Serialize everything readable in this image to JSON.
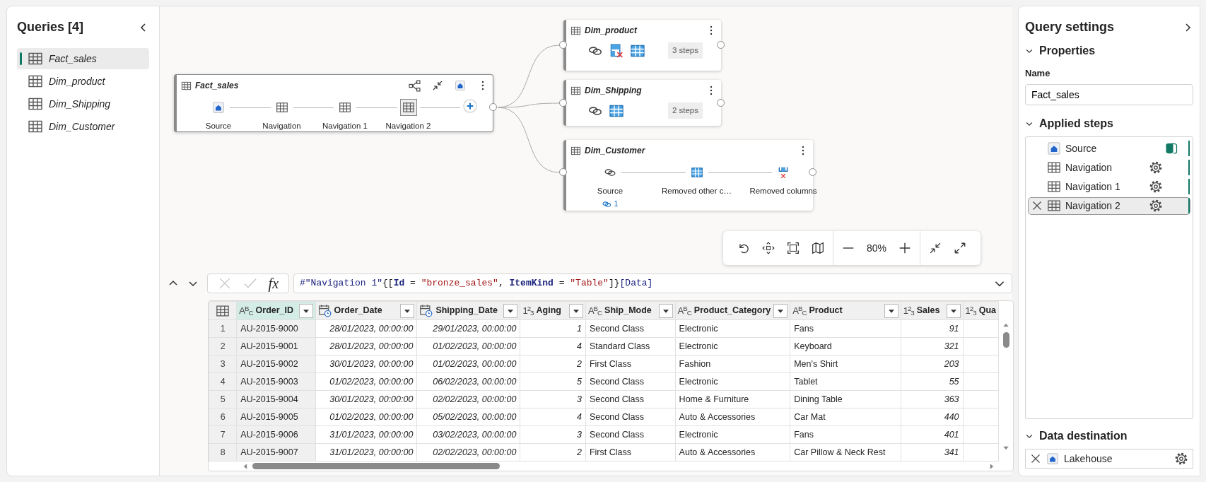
{
  "queries_panel": {
    "title": "Queries [4]",
    "items": [
      {
        "label": "Fact_sales",
        "selected": true
      },
      {
        "label": "Dim_product",
        "selected": false
      },
      {
        "label": "Dim_Shipping",
        "selected": false
      },
      {
        "label": "Dim_Customer",
        "selected": false
      }
    ]
  },
  "diagram": {
    "nodes": [
      {
        "title": "Fact_sales",
        "expanded": true,
        "selected": true,
        "steps": [
          {
            "label": "Source",
            "kind": "lakehouse",
            "selected": false
          },
          {
            "label": "Navigation",
            "kind": "table",
            "selected": false
          },
          {
            "label": "Navigation 1",
            "kind": "table",
            "selected": false
          },
          {
            "label": "Navigation 2",
            "kind": "table",
            "selected": true
          }
        ]
      },
      {
        "title": "Dim_product",
        "expanded": false,
        "selected": false,
        "steps": [
          {
            "kind": "link"
          },
          {
            "kind": "removerows"
          },
          {
            "kind": "grid"
          }
        ],
        "step_count": "3 steps"
      },
      {
        "title": "Dim_Shipping",
        "expanded": false,
        "selected": false,
        "steps": [
          {
            "kind": "link"
          },
          {
            "kind": "grid"
          }
        ],
        "step_count": "2 steps"
      },
      {
        "title": "Dim_Customer",
        "expanded": true,
        "selected": false,
        "steps": [
          {
            "label": "Source",
            "kind": "link",
            "selected": false,
            "link_count": "1"
          },
          {
            "label": "Removed other c…",
            "kind": "grid",
            "selected": false
          },
          {
            "label": "Removed columns",
            "kind": "removecols",
            "selected": false
          }
        ]
      }
    ],
    "zoom": "80%"
  },
  "formula": {
    "fx": "fx",
    "tokens": [
      {
        "text": "#\"Navigation 1\"",
        "kind": "name"
      },
      {
        "text": "{[",
        "kind": "plain"
      },
      {
        "text": "Id",
        "kind": "keyword"
      },
      {
        "text": " = ",
        "kind": "plain"
      },
      {
        "text": "\"bronze_sales\"",
        "kind": "string"
      },
      {
        "text": ", ",
        "kind": "plain"
      },
      {
        "text": "ItemKind",
        "kind": "keyword"
      },
      {
        "text": " = ",
        "kind": "plain"
      },
      {
        "text": "\"Table\"",
        "kind": "string"
      },
      {
        "text": "]}",
        "kind": "plain"
      },
      {
        "text": "[Data]",
        "kind": "name"
      }
    ]
  },
  "table": {
    "columns": [
      {
        "name": "Order_ID",
        "kind": "text",
        "type_label": "A$^{B}$$_{C}$",
        "selected": true,
        "filter_button": true
      },
      {
        "name": "Order_Date",
        "kind": "datetime",
        "selected": false,
        "filter_button": true
      },
      {
        "name": "Shipping_Date",
        "kind": "datetime",
        "selected": false,
        "filter_button": true
      },
      {
        "name": "Aging",
        "kind": "number",
        "type_label": "1$^{2}$$_{3}$",
        "selected": false,
        "filter_button": true
      },
      {
        "name": "Ship_Mode",
        "kind": "text",
        "type_label": "A$^{B}$$_{C}$",
        "selected": false,
        "filter_button": true
      },
      {
        "name": "Product_Category",
        "kind": "text",
        "type_label": "A$^{B}$$_{C}$",
        "selected": false,
        "filter_button": true
      },
      {
        "name": "Product",
        "kind": "text",
        "type_label": "A$^{B}$$_{C}$",
        "selected": false,
        "filter_button": true
      },
      {
        "name": "Sales",
        "kind": "number",
        "type_label": "1$^{2}$$_{3}$",
        "selected": false,
        "filter_button": true
      },
      {
        "name": "Qua",
        "kind": "number",
        "type_label": "1$^{2}$$_{3}$",
        "selected": false,
        "filter_button": false
      }
    ],
    "rows": [
      {
        "number": "1",
        "cells": [
          "AU-2015-9000",
          "28/01/2023, 00:00:00",
          "29/01/2023, 00:00:00",
          "1",
          "Second Class",
          "Electronic",
          "Fans",
          "91"
        ]
      },
      {
        "number": "2",
        "cells": [
          "AU-2015-9001",
          "28/01/2023, 00:00:00",
          "01/02/2023, 00:00:00",
          "4",
          "Standard Class",
          "Electronic",
          "Keyboard",
          "321"
        ]
      },
      {
        "number": "3",
        "cells": [
          "AU-2015-9002",
          "30/01/2023, 00:00:00",
          "01/02/2023, 00:00:00",
          "2",
          "First Class",
          "Fashion",
          "Men's Shirt",
          "203"
        ]
      },
      {
        "number": "4",
        "cells": [
          "AU-2015-9003",
          "01/02/2023, 00:00:00",
          "06/02/2023, 00:00:00",
          "5",
          "Second Class",
          "Electronic",
          "Tablet",
          "55"
        ]
      },
      {
        "number": "5",
        "cells": [
          "AU-2015-9004",
          "30/01/2023, 00:00:00",
          "02/02/2023, 00:00:00",
          "3",
          "Second Class",
          "Home & Furniture",
          "Dining Table",
          "363"
        ]
      },
      {
        "number": "6",
        "cells": [
          "AU-2015-9005",
          "01/02/2023, 00:00:00",
          "05/02/2023, 00:00:00",
          "4",
          "Second Class",
          "Auto & Accessories",
          "Car Mat",
          "440"
        ]
      },
      {
        "number": "7",
        "cells": [
          "AU-2015-9006",
          "31/01/2023, 00:00:00",
          "03/02/2023, 00:00:00",
          "3",
          "Second Class",
          "Electronic",
          "Fans",
          "401"
        ]
      },
      {
        "number": "8",
        "cells": [
          "AU-2015-9007",
          "31/01/2023, 00:00:00",
          "02/02/2023, 00:00:00",
          "2",
          "First Class",
          "Auto & Accessories",
          "Car Pillow & Neck Rest",
          "341"
        ]
      }
    ]
  },
  "query_settings": {
    "title": "Query settings",
    "properties": {
      "heading": "Properties",
      "expanded": true,
      "name_label": "Name",
      "name_value": "Fact_sales"
    },
    "applied_steps": {
      "heading": "Applied steps",
      "expanded": true,
      "steps": [
        {
          "label": "Source",
          "kind": "lakehouse",
          "selected": false,
          "folded": true
        },
        {
          "label": "Navigation",
          "kind": "table",
          "selected": false,
          "folded": true
        },
        {
          "label": "Navigation 1",
          "kind": "table",
          "selected": false,
          "folded": true
        },
        {
          "label": "Navigation 2",
          "kind": "table",
          "selected": true,
          "folded": true
        }
      ]
    },
    "data_destination": {
      "heading": "Data destination",
      "expanded": true,
      "label": "Lakehouse"
    }
  }
}
